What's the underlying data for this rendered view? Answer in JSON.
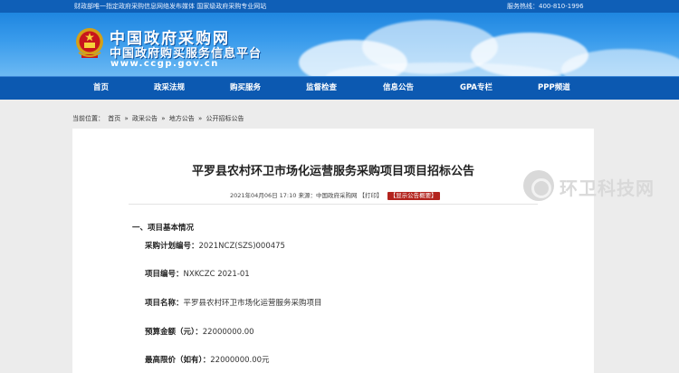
{
  "topbar": {
    "left_text": "财政部唯一指定政府采购信息网络发布媒体 国家级政府采购专业网站",
    "right_text": "服务热线：400-810-1996"
  },
  "header": {
    "title_cn": "中国政府采购网",
    "subtitle_cn": "中国政府购买服务信息平台",
    "url": "www.ccgp.gov.cn"
  },
  "nav": {
    "items": [
      {
        "label": "首页"
      },
      {
        "label": "政采法规"
      },
      {
        "label": "购买服务"
      },
      {
        "label": "监督检查"
      },
      {
        "label": "信息公告"
      },
      {
        "label": "GPA专栏"
      },
      {
        "label": "PPP频道"
      }
    ]
  },
  "breadcrumb": {
    "prefix": "当前位置：",
    "items": [
      "首页",
      "政采公告",
      "地方公告",
      "公开招标公告"
    ],
    "separator": "»"
  },
  "document": {
    "title": "平罗县农村环卫市场化运营服务采购项目项目招标公告",
    "meta_text": "2021年04月06日 17:10 来源：中国政府采购网 【打印】",
    "show_summary_button": "【显示公告概要】",
    "section1_title": "一、项目基本情况",
    "fields": [
      {
        "key": "采购计划编号：",
        "value": "2021NCZ(SZS)000475"
      },
      {
        "key": "项目编号：",
        "value": "NXKCZC 2021-01"
      },
      {
        "key": "项目名称：",
        "value": "平罗县农村环卫市场化运营服务采购项目"
      },
      {
        "key": "预算金额（元）：",
        "value": "22000000.00"
      },
      {
        "key": "最高限价（如有）：",
        "value": "22000000.00元"
      }
    ]
  },
  "watermark": {
    "text": "环卫科技网"
  },
  "colors": {
    "topbar": "#0f5fb7",
    "nav": "#0c59b1",
    "accent_red": "#b3241e"
  }
}
